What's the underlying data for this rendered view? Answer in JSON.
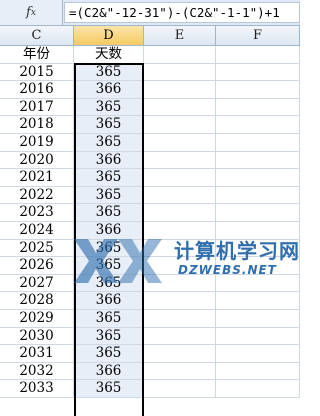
{
  "formula_bar": {
    "icon": "fx-icon",
    "formula": "=(C2&\"-12-31\")-(C2&\"-1-1\")+1"
  },
  "columns": [
    {
      "label": "C",
      "selected": false
    },
    {
      "label": "D",
      "selected": true
    },
    {
      "label": "E",
      "selected": false
    },
    {
      "label": "F",
      "selected": false
    }
  ],
  "header_row": {
    "year": "年份",
    "days": "天数"
  },
  "rows": [
    {
      "year": "2015",
      "days": "365"
    },
    {
      "year": "2016",
      "days": "366"
    },
    {
      "year": "2017",
      "days": "365"
    },
    {
      "year": "2018",
      "days": "365"
    },
    {
      "year": "2019",
      "days": "365"
    },
    {
      "year": "2020",
      "days": "366"
    },
    {
      "year": "2021",
      "days": "365"
    },
    {
      "year": "2022",
      "days": "365"
    },
    {
      "year": "2023",
      "days": "365"
    },
    {
      "year": "2024",
      "days": "366"
    },
    {
      "year": "2025",
      "days": "365"
    },
    {
      "year": "2026",
      "days": "365"
    },
    {
      "year": "2027",
      "days": "365"
    },
    {
      "year": "2028",
      "days": "366"
    },
    {
      "year": "2029",
      "days": "365"
    },
    {
      "year": "2030",
      "days": "365"
    },
    {
      "year": "2031",
      "days": "365"
    },
    {
      "year": "2032",
      "days": "366"
    },
    {
      "year": "2033",
      "days": "365"
    }
  ],
  "watermark": {
    "title": "计算机学习网",
    "subtitle": "DZWEBS.NET"
  },
  "colors": {
    "selection_fill": "#e8eef8",
    "header_selected": "#f6c962",
    "watermark": "#2f6fae"
  }
}
